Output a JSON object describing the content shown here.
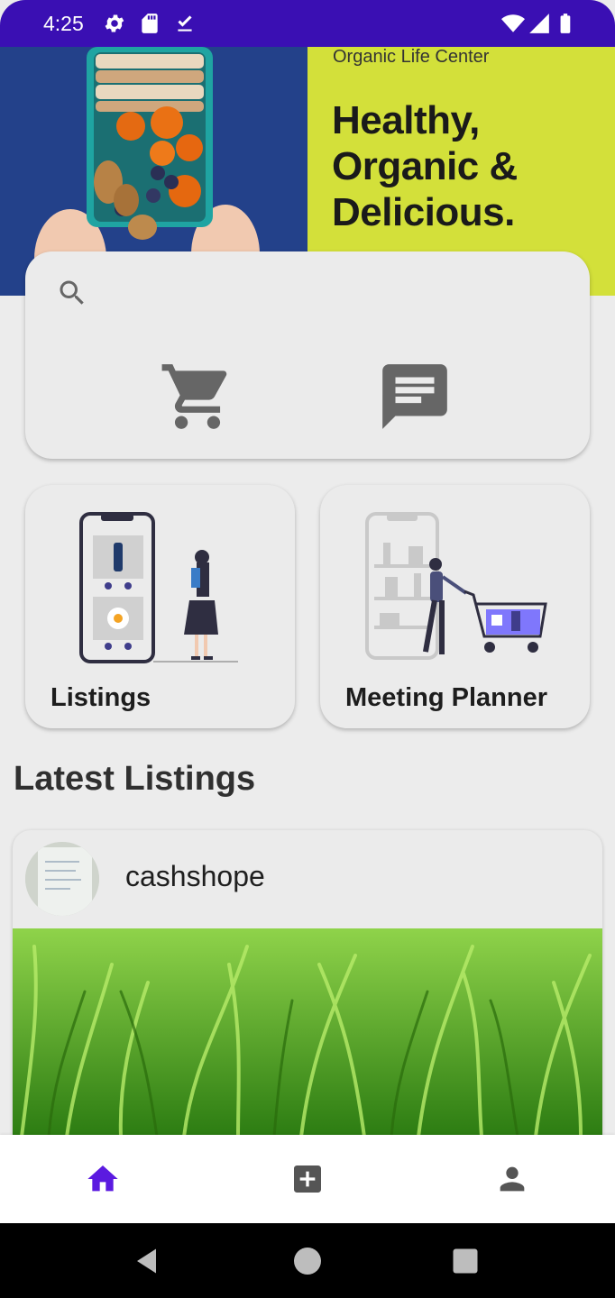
{
  "status_bar": {
    "time": "4:25",
    "left_icons": [
      "gear-icon",
      "sd-card-icon",
      "download-done-icon"
    ],
    "right_icons": [
      "wifi-icon",
      "signal-icon",
      "battery-icon"
    ]
  },
  "banner": {
    "kicker": "Organic Life Center",
    "headline_lines": [
      "Healthy,",
      "Organic &",
      "Delicious."
    ],
    "colors": {
      "left_bg": "#23418a",
      "right_bg": "#d3e03a"
    }
  },
  "quick_actions": {
    "search_icon": "search-icon",
    "cart_icon": "shopping-cart-icon",
    "chat_icon": "chat-icon"
  },
  "tiles": [
    {
      "label": "Listings",
      "illustration": "phone-shopper-illustration"
    },
    {
      "label": "Meeting Planner",
      "illustration": "shopping-cart-illustration"
    }
  ],
  "latest_listings": {
    "title": "Latest Listings",
    "items": [
      {
        "seller": "cashshope",
        "photo": "grass-photo"
      }
    ]
  },
  "bottom_nav": {
    "items": [
      "home-icon",
      "add-box-icon",
      "person-icon"
    ],
    "active_color": "#5b1ae0",
    "inactive_color": "#555555"
  },
  "system_nav": [
    "back-icon",
    "home-circle-icon",
    "recents-icon"
  ]
}
